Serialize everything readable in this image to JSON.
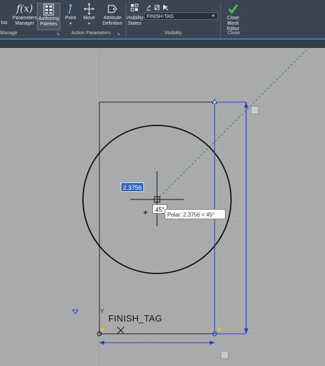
{
  "ribbon": {
    "status_label": "tus",
    "parameters_manager": "Parameters\nManager",
    "authoring_palettes": "Authoring\nPalettes",
    "point": "Point",
    "move": "Move",
    "attribute_definition": "Attribute\nDefinition",
    "visibility_states": "Visibility\nStates",
    "visibility_state_value": "FINISH-TAG",
    "close_block_editor": "Close\nBlock Editor",
    "groups": {
      "manage": "Manage",
      "action_parameters": "Action Parameters",
      "visibility": "Visibility",
      "close": "Close"
    }
  },
  "canvas": {
    "dynamic_input_value": "2.3756",
    "angle_value": "45°",
    "polar_tooltip": "Polar: 2.3756 < 45°",
    "block_text": "FINISH_TAG",
    "ucs_y_label": "Y"
  },
  "colors": {
    "ribbon_bg": "#3b4453",
    "canvas_bg": "#a9aaac",
    "accent_blue": "#2f7fc6",
    "dimension_blue": "#1e3fd0",
    "polar_track_green": "#2e9a3a",
    "grip_yellow": "#f2c21a"
  }
}
